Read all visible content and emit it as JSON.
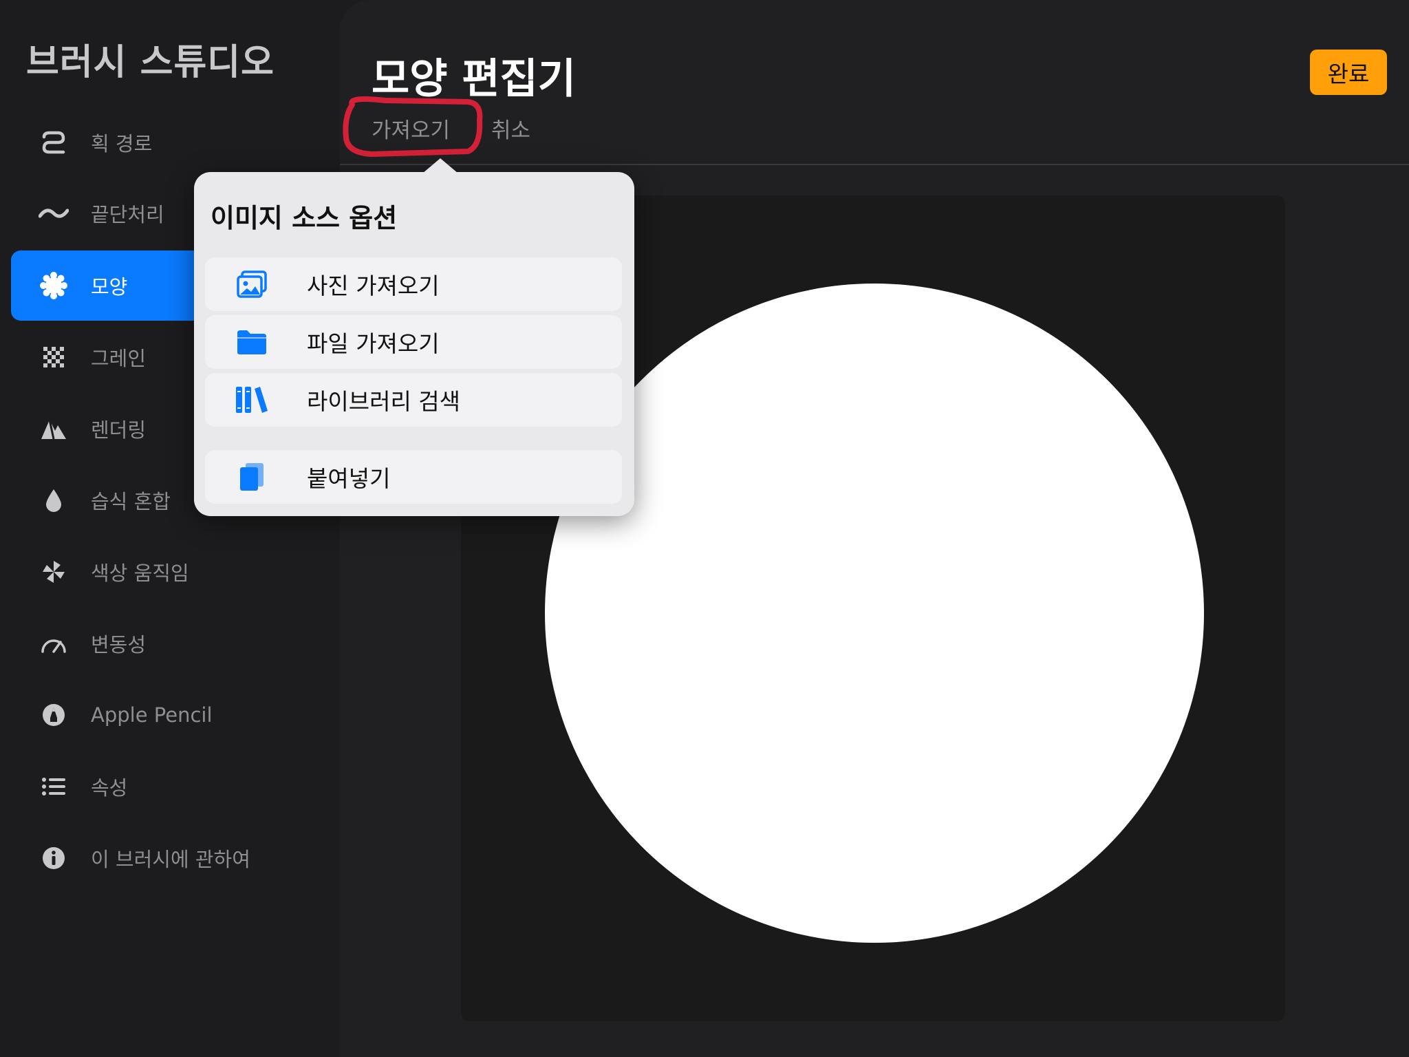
{
  "sidebar": {
    "title": "브러시 스튜디오",
    "items": [
      {
        "label": "획 경로",
        "icon": "stroke-path-icon"
      },
      {
        "label": "끝단처리",
        "icon": "taper-icon"
      },
      {
        "label": "모양",
        "icon": "shape-icon",
        "active": true
      },
      {
        "label": "그레인",
        "icon": "grain-icon"
      },
      {
        "label": "렌더링",
        "icon": "rendering-icon"
      },
      {
        "label": "습식 혼합",
        "icon": "wet-mix-icon"
      },
      {
        "label": "색상 움직임",
        "icon": "color-dynamics-icon"
      },
      {
        "label": "변동성",
        "icon": "dynamics-icon"
      },
      {
        "label": "Apple Pencil",
        "icon": "apple-pencil-icon"
      },
      {
        "label": "속성",
        "icon": "properties-icon"
      },
      {
        "label": "이 브러시에 관하여",
        "icon": "info-icon"
      }
    ]
  },
  "main": {
    "title": "모양 편집기",
    "tabs": {
      "import": "가져오기",
      "cancel": "취소"
    },
    "done_label": "완료"
  },
  "popover": {
    "title": "이미지 소스 옵션",
    "items": [
      {
        "label": "사진 가져오기",
        "icon": "photo-icon"
      },
      {
        "label": "파일 가져오기",
        "icon": "folder-icon"
      },
      {
        "label": "라이브러리 검색",
        "icon": "library-icon"
      },
      {
        "label": "붙여넣기",
        "icon": "paste-icon"
      }
    ]
  },
  "colors": {
    "accent": "#0a7aff",
    "done": "#ff9f0a",
    "annotation": "#e8213a"
  }
}
